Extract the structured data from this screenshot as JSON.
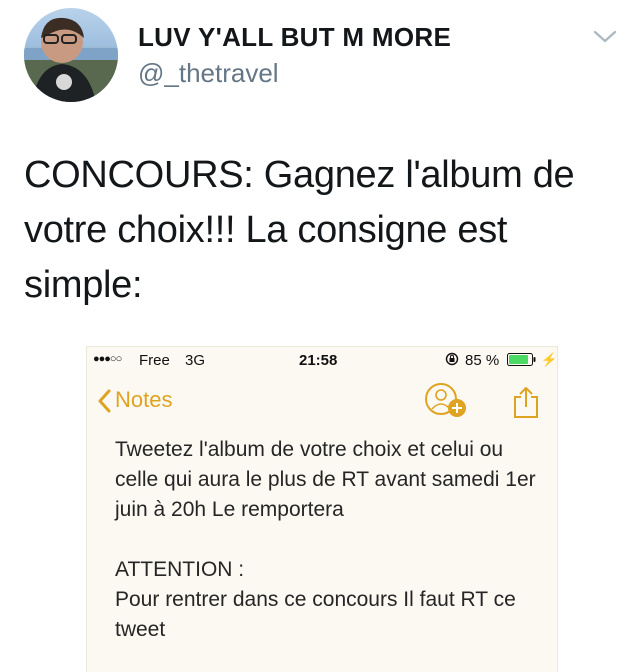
{
  "tweet": {
    "display_name": "LUV Y'ALL BUT M MORE",
    "username": "@_thetravel",
    "text": "CONCOURS: Gagnez l'album de votre choix!!! La consigne est simple:"
  },
  "embedded_screenshot": {
    "status_bar": {
      "signal": "●●●○○",
      "carrier": "Free",
      "network": "3G",
      "time": "21:58",
      "battery": "85 %"
    },
    "nav": {
      "back_label": "Notes"
    },
    "note": {
      "paragraph1": "Tweetez l'album de votre choix et celui ou celle qui aura le plus de RT avant samedi 1er juin à 20h Le remportera",
      "paragraph2_title": "ATTENTION :",
      "paragraph2_body": "Pour rentrer dans ce concours Il faut RT ce tweet"
    }
  },
  "colors": {
    "accent": "#dfa322",
    "username": "#657786",
    "battery_fill": "#4cd964"
  },
  "icons": [
    "chevron-down-icon",
    "lock-rotation-icon",
    "battery-icon",
    "charging-icon",
    "back-chevron-icon",
    "contact-add-icon",
    "share-icon"
  ]
}
